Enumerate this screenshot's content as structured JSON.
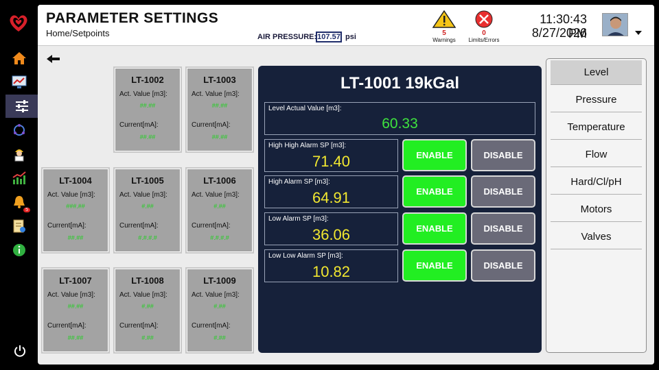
{
  "header": {
    "title": "PARAMETER SETTINGS",
    "breadcrumb": "Home/Setpoints",
    "air_pressure_label": "AIR PRESSURE:",
    "air_pressure_value": "107.57",
    "air_pressure_unit": "psi",
    "warnings_count": "5",
    "warnings_label": "Warnings",
    "errors_count": "0",
    "errors_label": "Limits/Errors",
    "time": "11:30:43 PM",
    "date": "8/27/2026"
  },
  "sidebar": {
    "items": [
      {
        "name": "home-icon"
      },
      {
        "name": "monitor-chart-icon"
      },
      {
        "name": "sliders-icon",
        "active": true
      },
      {
        "name": "refresh-cycle-icon"
      },
      {
        "name": "worker-icon"
      },
      {
        "name": "trend-chart-icon"
      },
      {
        "name": "bell-icon",
        "badge": "5"
      },
      {
        "name": "report-icon"
      },
      {
        "name": "info-icon"
      }
    ],
    "power": "power-icon"
  },
  "cards": [
    {
      "tag": "LT-1002",
      "act_label": "Act. Value [m3]:",
      "act_value": "##.##",
      "cur_label": "Current[mA]:",
      "cur_value": "##.##"
    },
    {
      "tag": "LT-1003",
      "act_label": "Act. Value [m3]:",
      "act_value": "##.##",
      "cur_label": "Current[mA]:",
      "cur_value": "##.##"
    },
    {
      "tag": "LT-1004",
      "act_label": "Act. Value [m3]:",
      "act_value": "###.##",
      "cur_label": "Current[mA]:",
      "cur_value": "##.##"
    },
    {
      "tag": "LT-1005",
      "act_label": "Act. Value [m3]:",
      "act_value": "#.##",
      "cur_label": "Current[mA]:",
      "cur_value": "#.#.#.#"
    },
    {
      "tag": "LT-1006",
      "act_label": "Act. Value [m3]:",
      "act_value": "#.##",
      "cur_label": "Current[mA]:",
      "cur_value": "#.#.#.#"
    },
    {
      "tag": "LT-1007",
      "act_label": "Act. Value [m3]:",
      "act_value": "##.##",
      "cur_label": "Current[mA]:",
      "cur_value": "##.##"
    },
    {
      "tag": "LT-1008",
      "act_label": "Act. Value [m3]:",
      "act_value": "#.##",
      "cur_label": "Current[mA]:",
      "cur_value": "#.##"
    },
    {
      "tag": "LT-1009",
      "act_label": "Act. Value [m3]:",
      "act_value": "#.##",
      "cur_label": "Current[mA]:",
      "cur_value": "#.##"
    }
  ],
  "panel": {
    "title": "LT-1001 19kGal",
    "level_label": "Level Actual Value [m3]:",
    "level_value": "60.33",
    "setpoints": [
      {
        "label": "High High Alarm SP [m3]:",
        "value": "71.40",
        "enable": "ENABLE",
        "disable": "DISABLE"
      },
      {
        "label": "High Alarm SP [m3]:",
        "value": "64.91",
        "enable": "ENABLE",
        "disable": "DISABLE"
      },
      {
        "label": "Low Alarm SP [m3]:",
        "value": "36.06",
        "enable": "ENABLE",
        "disable": "DISABLE"
      },
      {
        "label": "Low Low Alarm SP [m3]:",
        "value": "10.82",
        "enable": "ENABLE",
        "disable": "DISABLE"
      }
    ]
  },
  "rightnav": {
    "items": [
      "Level",
      "Pressure",
      "Temperature",
      "Flow",
      "Hard/Cl/pH",
      "Motors",
      "Valves"
    ],
    "active": "Level"
  },
  "colors": {
    "panel_bg": "#16213a",
    "enable_green": "#22ee22",
    "disable_gray": "#6a6a78",
    "setpoint_yellow": "#f2e830",
    "level_green": "#3ee33e"
  }
}
